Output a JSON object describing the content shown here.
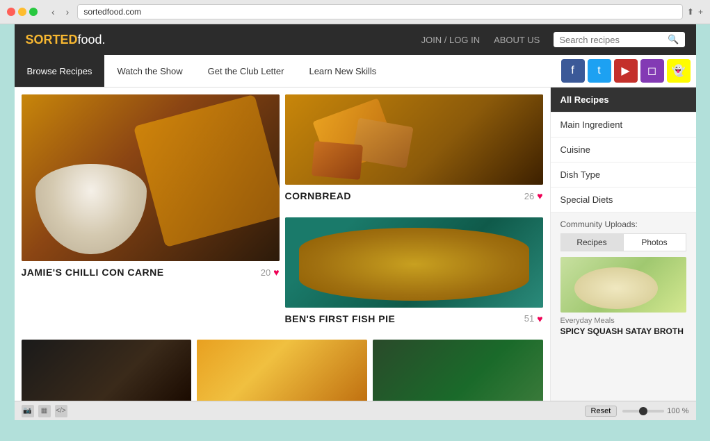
{
  "browser": {
    "address": "sortedfood.com",
    "zoom_label": "100 %"
  },
  "header": {
    "logo_sorted": "SORTED",
    "logo_food": "food.",
    "nav_join": "JOIN / LOG IN",
    "nav_about": "ABOUT US",
    "search_placeholder": "Search recipes"
  },
  "subnav": {
    "items": [
      {
        "id": "browse",
        "label": "Browse Recipes",
        "active": true
      },
      {
        "id": "watch",
        "label": "Watch the Show",
        "active": false
      },
      {
        "id": "club",
        "label": "Get the Club Letter",
        "active": false
      },
      {
        "id": "learn",
        "label": "Learn New Skills",
        "active": false
      }
    ]
  },
  "social": {
    "facebook": "f",
    "twitter": "t",
    "youtube": "▶",
    "instagram": "◻",
    "snapchat": "👻"
  },
  "recipes": {
    "featured": {
      "title": "JAMIE'S CHILLI CON CARNE",
      "likes": "20"
    },
    "cornbread": {
      "title": "CORNBREAD",
      "likes": "26"
    },
    "fish_pie": {
      "title": "BEN'S FIRST FISH PIE",
      "likes": "51"
    }
  },
  "sidebar": {
    "menu_items": [
      {
        "id": "all",
        "label": "All Recipes",
        "active": true
      },
      {
        "id": "ingredient",
        "label": "Main Ingredient",
        "active": false
      },
      {
        "id": "cuisine",
        "label": "Cuisine",
        "active": false
      },
      {
        "id": "dish_type",
        "label": "Dish Type",
        "active": false
      },
      {
        "id": "diets",
        "label": "Special Diets",
        "active": false
      }
    ],
    "community_label": "Community Uploads:",
    "community_tabs": [
      {
        "id": "recipes",
        "label": "Recipes",
        "active": true
      },
      {
        "id": "photos",
        "label": "Photos",
        "active": false
      }
    ],
    "community_recipe_tag": "Everyday Meals",
    "community_recipe_title": "SPICY SQUASH SATAY BROTH"
  },
  "bottom_bar": {
    "reset_label": "Reset",
    "zoom_label": "100 %"
  }
}
